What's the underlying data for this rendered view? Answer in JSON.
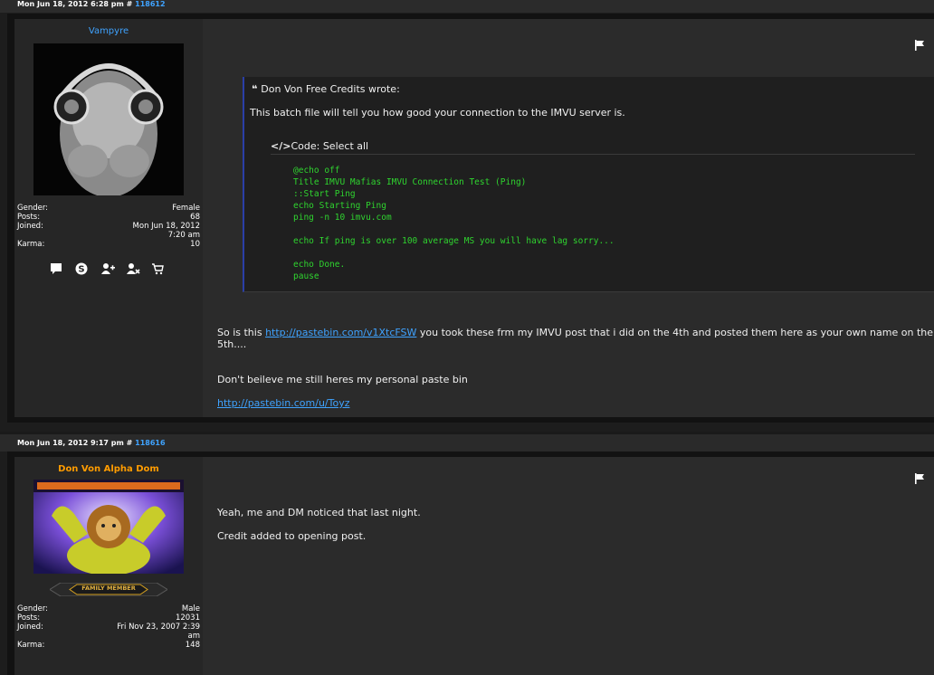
{
  "posts": [
    {
      "timestamp": "Mon Jun 18, 2012 6:28 pm",
      "separator": "#",
      "post_number": "118612",
      "author": "Vampyre",
      "avatar_icon": "headphones-woman-avatar",
      "stats": [
        {
          "label": "Gender:",
          "value": "Female"
        },
        {
          "label": "Posts:",
          "value": "68"
        },
        {
          "label": "Joined:",
          "value": "Mon Jun 18, 2012 7:20 am"
        },
        {
          "label": "Karma:",
          "value": "10"
        }
      ],
      "quote_title": "Don Von Free Credits wrote:",
      "quote_text": "This batch file will tell you how good your connection to the IMVU server is.",
      "code_label": "Code: Select all",
      "code": "@echo off\nTitle IMVU Mafias IMVU Connection Test (Ping)\n::Start Ping\necho Starting Ping\nping -n 10 imvu.com\n\necho If ping is over 100 average MS you will have lag sorry...\n\necho Done.\npause",
      "para1_prefix": "So is this ",
      "para1_link": "http://pastebin.com/v1XtcFSW",
      "para1_suffix": " you took these frm my IMVU post that i did on the 4th and posted them here as your own name on the 5th....",
      "para2": "Don't beileve me still heres my personal paste bin",
      "para3_link": "http://pastebin.com/u/Toyz"
    },
    {
      "timestamp": "Mon Jun 18, 2012 9:17 pm",
      "separator": "#",
      "post_number": "118616",
      "author": "Don Von Alpha Dom",
      "avatar_icon": "lion-bodybuilder-avatar",
      "rank_badge": "FAMILY MEMBER",
      "stats": [
        {
          "label": "Gender:",
          "value": "Male"
        },
        {
          "label": "Posts:",
          "value": "12031"
        },
        {
          "label": "Joined:",
          "value": "Fri Nov 23, 2007 2:39 am"
        },
        {
          "label": "Karma:",
          "value": "148"
        }
      ],
      "para1": "Yeah, me and DM noticed that last night.",
      "para2": "Credit added to opening post."
    }
  ],
  "icons": [
    "message-icon",
    "skype-icon",
    "add-friend-icon",
    "add-foe-icon",
    "cart-icon",
    "report-flag-icon",
    "quote-icon",
    "code-icon"
  ]
}
